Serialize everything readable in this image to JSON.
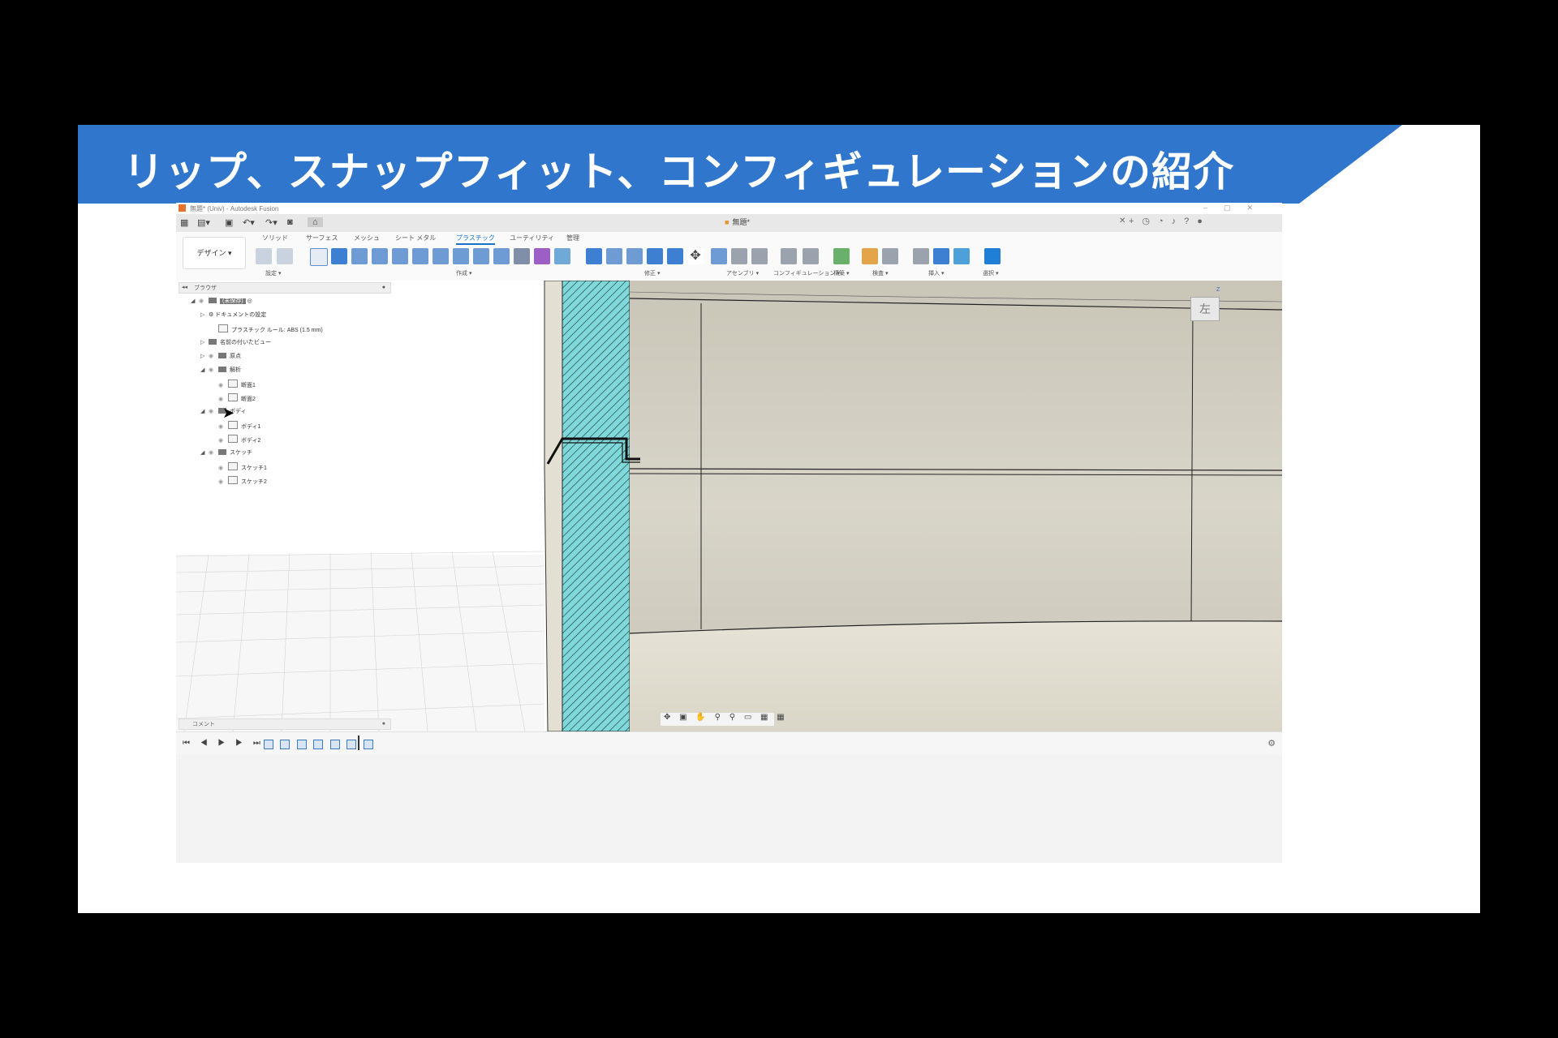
{
  "slide": {
    "title": "リップ、スナップフィット、コンフィギュレーションの紹介",
    "banner_color": "#2f76cc"
  },
  "app": {
    "window_title": "無題* (Univ) - Autodesk Fusion",
    "document_tab": "無題*",
    "workspace_button": "デザイン ▾",
    "ribbon_tabs": [
      "ソリッド",
      "サーフェス",
      "メッシュ",
      "シート メタル",
      "プラスチック",
      "ユーティリティ",
      "管理"
    ],
    "active_tab": "プラスチック",
    "ribbon_groups": [
      "設定 ▾",
      "作成 ▾",
      "修正 ▾",
      "アセンブリ ▾",
      "コンフィギュレーション ▾",
      "構築 ▾",
      "検査 ▾",
      "挿入 ▾",
      "選択 ▾"
    ],
    "browser": {
      "header": "ブラウザ",
      "items": [
        {
          "label": "(未保存)",
          "level": 0,
          "arrow": "◢",
          "kind": "root"
        },
        {
          "label": "ドキュメントの設定",
          "level": 1,
          "arrow": "▷",
          "kind": "gear"
        },
        {
          "label": "プラスチック ルール: ABS (1.5 mm)",
          "level": 2,
          "arrow": "",
          "kind": "rule"
        },
        {
          "label": "名前の付いたビュー",
          "level": 1,
          "arrow": "▷",
          "kind": "folder"
        },
        {
          "label": "原点",
          "level": 1,
          "arrow": "▷",
          "kind": "folder-eye"
        },
        {
          "label": "解析",
          "level": 1,
          "arrow": "◢",
          "kind": "folder-eye"
        },
        {
          "label": "断面1",
          "level": 2,
          "arrow": "",
          "kind": "item"
        },
        {
          "label": "断面2",
          "level": 2,
          "arrow": "",
          "kind": "item"
        },
        {
          "label": "ボディ",
          "level": 1,
          "arrow": "◢",
          "kind": "folder-eye"
        },
        {
          "label": "ボディ1",
          "level": 2,
          "arrow": "",
          "kind": "item"
        },
        {
          "label": "ボディ2",
          "level": 2,
          "arrow": "",
          "kind": "item"
        },
        {
          "label": "スケッチ",
          "level": 1,
          "arrow": "◢",
          "kind": "folder-eye"
        },
        {
          "label": "スケッチ1",
          "level": 2,
          "arrow": "",
          "kind": "item"
        },
        {
          "label": "スケッチ2",
          "level": 2,
          "arrow": "",
          "kind": "item"
        }
      ]
    },
    "comments_label": "コメント",
    "viewcube_label": "左",
    "axis_label": "Z",
    "navbar_icons": "✥ ▣ ✋ ⚲ ⚲ ▭ ▦ ▦",
    "timeline_controls": "⏮ ◀ ▶ ▶ ⏭",
    "section_color": "#7fd8d9"
  }
}
